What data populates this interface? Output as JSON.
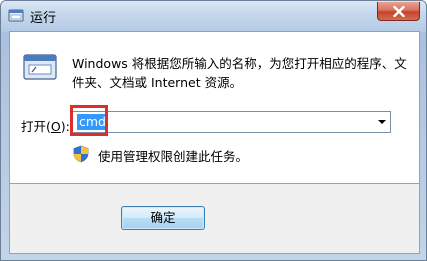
{
  "window": {
    "title": "运行"
  },
  "content": {
    "description": "Windows 将根据您所输入的名称，为您打开相应的程序、文件夹、文档或 Internet 资源。",
    "open_label_prefix": "打开(",
    "open_label_key": "O",
    "open_label_suffix": "):",
    "command_value": "cmd",
    "admin_note": "使用管理权限创建此任务。"
  },
  "buttons": {
    "ok_label": "确定"
  },
  "colors": {
    "selection": "#3399ff",
    "highlight_box": "#d9302a",
    "close_button": "#c5432c"
  },
  "icons": [
    "run-app-icon",
    "close-icon",
    "run-dialog-icon",
    "uac-shield-icon",
    "dropdown-arrow-icon"
  ]
}
